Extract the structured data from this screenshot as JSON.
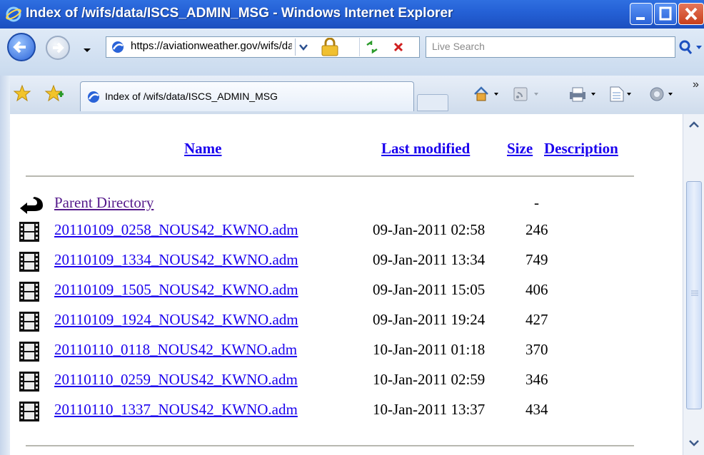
{
  "window": {
    "title": "Index of /wifs/data/ISCS_ADMIN_MSG - Windows Internet Explorer"
  },
  "navbar": {
    "address": "https://aviationweather.gov/wifs/data/ISCS_ADMIN_MSG/",
    "search_placeholder": "Live Search"
  },
  "tabbar": {
    "tab_title": "Index of /wifs/data/ISCS_ADMIN_MSG"
  },
  "listing": {
    "headers": {
      "name": "Name",
      "last_modified": "Last modified",
      "size": "Size",
      "description": "Description"
    },
    "parent": {
      "label": "Parent Directory",
      "size": "-"
    },
    "files": [
      {
        "name": "20110109_0258_NOUS42_KWNO.adm",
        "modified": "09-Jan-2011 02:58",
        "size": "246"
      },
      {
        "name": "20110109_1334_NOUS42_KWNO.adm",
        "modified": "09-Jan-2011 13:34",
        "size": "749"
      },
      {
        "name": "20110109_1505_NOUS42_KWNO.adm",
        "modified": "09-Jan-2011 15:05",
        "size": "406"
      },
      {
        "name": "20110109_1924_NOUS42_KWNO.adm",
        "modified": "09-Jan-2011 19:24",
        "size": "427"
      },
      {
        "name": "20110110_0118_NOUS42_KWNO.adm",
        "modified": "10-Jan-2011 01:18",
        "size": "370"
      },
      {
        "name": "20110110_0259_NOUS42_KWNO.adm",
        "modified": "10-Jan-2011 02:59",
        "size": "346"
      },
      {
        "name": "20110110_1337_NOUS42_KWNO.adm",
        "modified": "10-Jan-2011 13:37",
        "size": "434"
      }
    ]
  },
  "colors": {
    "link": "#1a00ee",
    "visited": "#551a8b",
    "titlebar": "#2561d6"
  }
}
